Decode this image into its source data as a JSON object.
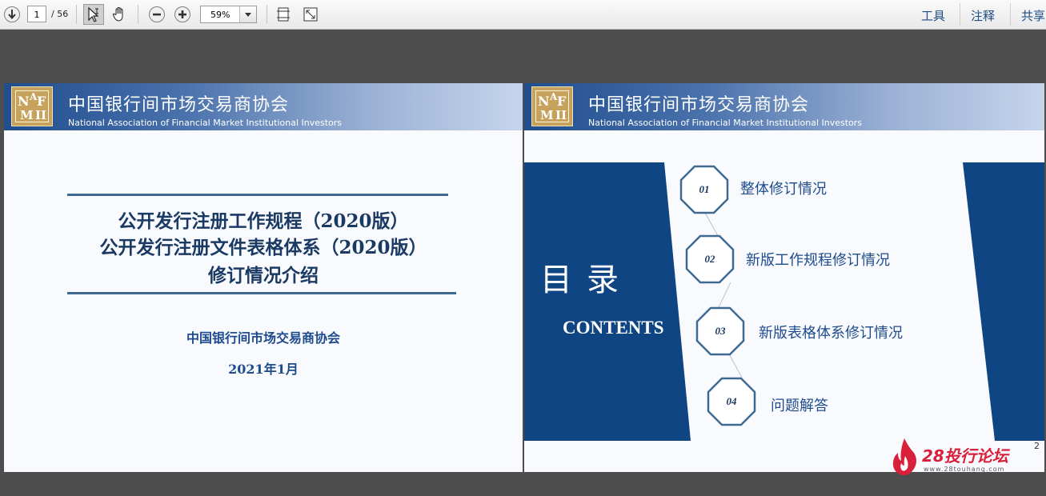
{
  "toolbar": {
    "current_page": "1",
    "page_count": "/ 56",
    "zoom": "59%",
    "right_links": [
      "工具",
      "注释",
      "共享"
    ]
  },
  "slide1": {
    "org_cn": "中国银行间市场交易商协会",
    "org_en": "National Association of Financial Market Institutional Investors",
    "logo_text": "NAFMII",
    "title_lines": [
      "公开发行注册工作规程（2020版）",
      "公开发行注册文件表格体系（2020版）",
      "修订情况介绍"
    ],
    "issuer": "中国银行间市场交易商协会",
    "date": "2021年1月"
  },
  "slide2": {
    "org_cn": "中国银行间市场交易商协会",
    "org_en": "National Association of Financial Market Institutional Investors",
    "logo_text": "NAFMII",
    "toc_title": "目录",
    "toc_en": "CONTENTS",
    "items": [
      {
        "num": "01",
        "label": "整体修订情况"
      },
      {
        "num": "02",
        "label": "新版工作规程修订情况"
      },
      {
        "num": "03",
        "label": "新版表格体系修订情况"
      },
      {
        "num": "04",
        "label": "问题解答"
      }
    ],
    "page_number": "2"
  },
  "watermark": {
    "brand": "28投行论坛",
    "url": "www.28touhang.com"
  },
  "colors": {
    "navy": "#0f4583",
    "title": "#1a3a63",
    "link": "#1d4d86"
  }
}
